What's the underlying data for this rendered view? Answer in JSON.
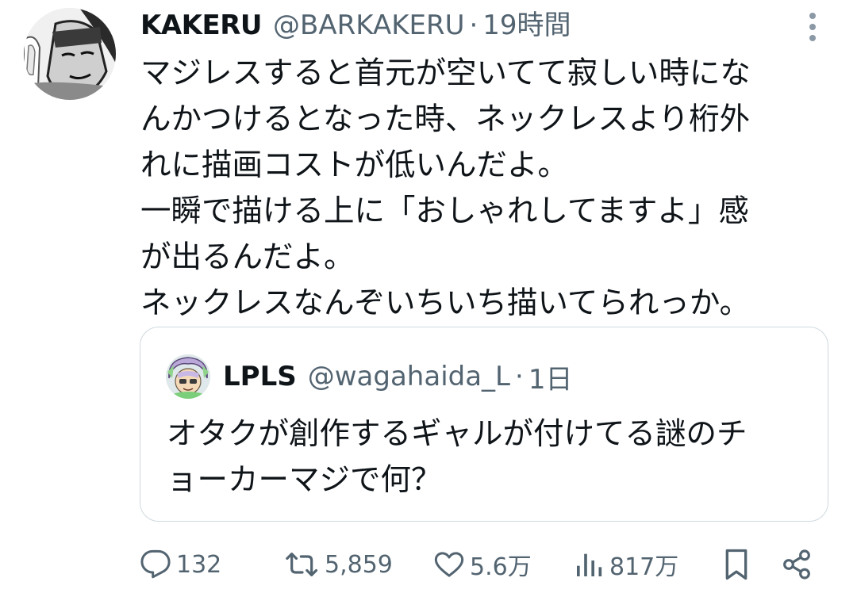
{
  "tweet": {
    "author_name": "KAKERU",
    "author_handle": "@BARKAKERU",
    "separator": "·",
    "time": "19時間",
    "text_lines": [
      "マジレスすると首元が空いてて寂しい時にな",
      "んかつけるとなった時、ネックレスより桁外",
      "れに描画コストが低いんだよ。",
      "一瞬で描ける上に「おしゃれしてますよ」感",
      "が出るんだよ。",
      "ネックレスなんぞいちいち描いてられっか。"
    ]
  },
  "quote": {
    "author_name": "LPLS",
    "author_handle": "@wagahaida_L",
    "separator": "·",
    "time": "1日",
    "text_lines": [
      "オタクが創作するギャルが付けてる謎のチ",
      "ョーカーマジで何？"
    ]
  },
  "actions": {
    "replies": "132",
    "reposts": "5,859",
    "likes": "5.6万",
    "views": "817万"
  },
  "icons": {
    "more": "more-vertical-icon",
    "reply": "reply-bubble-icon",
    "repost": "repost-icon",
    "like": "heart-icon",
    "views": "views-bar-chart-icon",
    "bookmark": "bookmark-icon",
    "share": "share-icon"
  },
  "colors": {
    "text_primary": "#0f1419",
    "text_secondary": "#536471",
    "border": "#cfd9de",
    "background": "#ffffff"
  }
}
